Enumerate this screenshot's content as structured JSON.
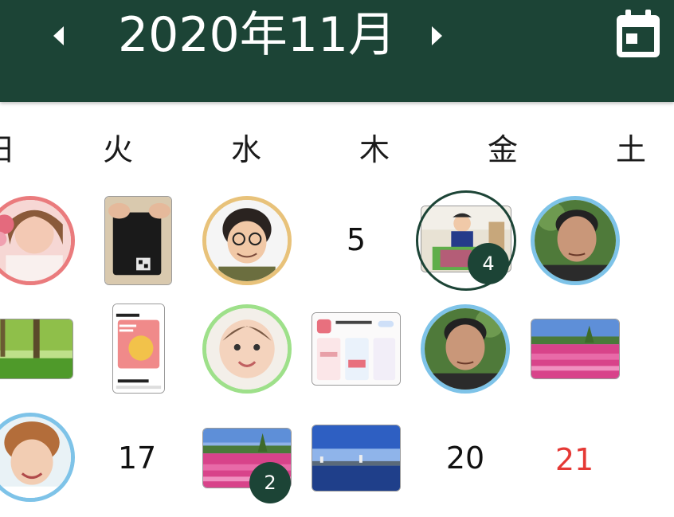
{
  "header": {
    "title": "2020年11月",
    "prev_icon": "chevron-left-icon",
    "next_icon": "chevron-right-icon",
    "calendar_icon": "calendar-icon",
    "background": "#1c4436"
  },
  "weekdays": [
    "日",
    "火",
    "水",
    "木",
    "金",
    "土"
  ],
  "dates": {
    "d5": "5",
    "d17": "17",
    "d20": "20",
    "d21": "21"
  },
  "badges": {
    "nov6": "4",
    "nov18": "2"
  },
  "colors": {
    "accent": "#1c4436",
    "saturday_date": "#e53935",
    "ring_pink": "#ea7b7d",
    "ring_yellow": "#e8c27a",
    "ring_blue": "#7ec3e8",
    "ring_green": "#9ee08a"
  }
}
